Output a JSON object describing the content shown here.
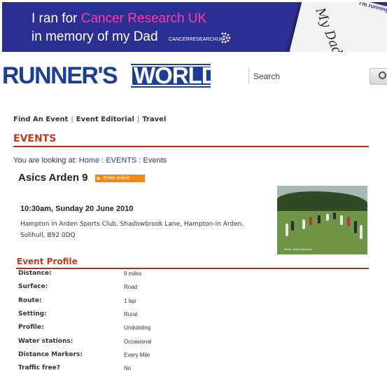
{
  "banner": {
    "line1_prefix": "I ran for ",
    "line1_accent": "Cancer Research UK",
    "line2": "in memory of my Dad",
    "brand": "CANCERRESEARCHUK",
    "card_text": "My Dad's",
    "card_small": "I'm running",
    "accent_color": "#ff3aa6",
    "background_color": "#2b2f91"
  },
  "logo": {
    "runners": "RUNNER'S",
    "world": "WORLD",
    "brand_color": "#1c3f94"
  },
  "search": {
    "placeholder": "Search",
    "button_icon": "search-icon"
  },
  "nav": {
    "items": [
      "Find An Event",
      "Event Editorial",
      "Travel"
    ]
  },
  "section": {
    "title": "EVENTS",
    "accent_color": "#c03b22"
  },
  "breadcrumb": {
    "prefix": "You are looking at: ",
    "home": "Home",
    "events": "EVENTS",
    "current": "Events",
    "separator": ":"
  },
  "event": {
    "name": "Asics Arden 9",
    "enter_label": "Enter online",
    "datetime": "10:30am, Sunday 20 June 2010",
    "address_line1": "Hampton in Arden Sports Club, Shadowbrook Lane, Hampton-in Arden,",
    "address_line2": "Solihull, B92 0DQ",
    "photo_caption": "Photo: Martin Bennett"
  },
  "profile": {
    "title": "Event Profile",
    "rows": [
      {
        "label": "Distance:",
        "value": "9 miles"
      },
      {
        "label": "Surface:",
        "value": "Road"
      },
      {
        "label": "Route:",
        "value": "1 lap"
      },
      {
        "label": "Setting:",
        "value": "Rural"
      },
      {
        "label": "Profile:",
        "value": "Undulating"
      },
      {
        "label": "Water stations:",
        "value": "Occasional"
      },
      {
        "label": "Distance Markers:",
        "value": "Every Mile"
      },
      {
        "label": "Traffic free?",
        "value": "No"
      }
    ]
  }
}
